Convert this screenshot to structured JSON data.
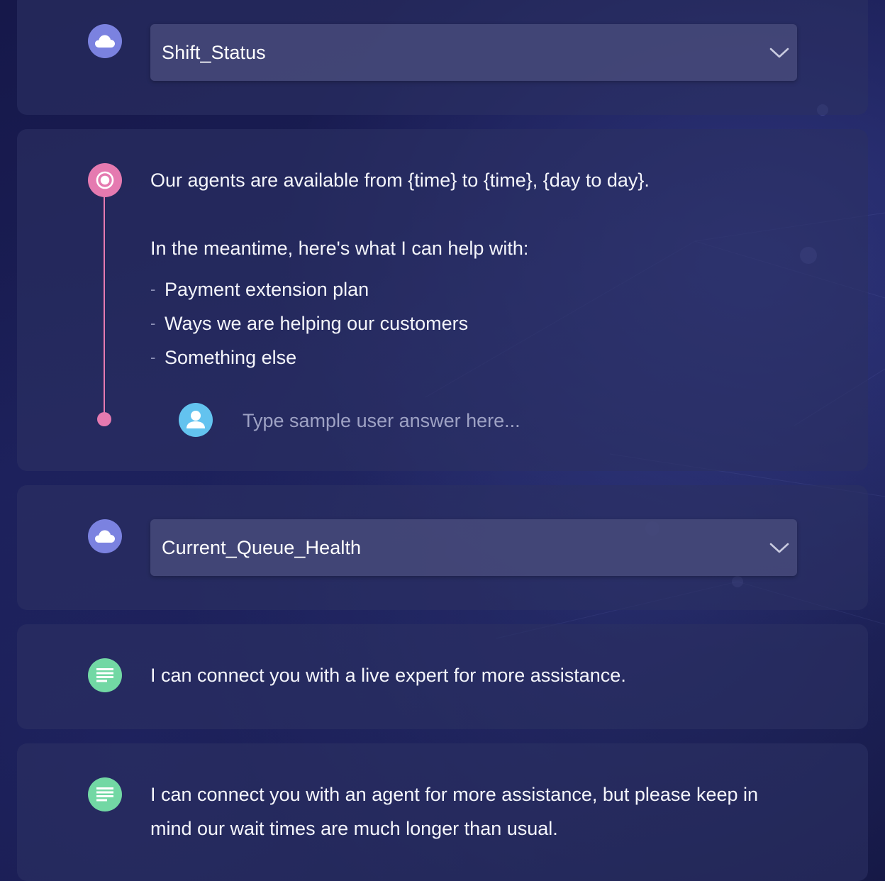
{
  "flow": {
    "nodes": [
      {
        "type": "api-call",
        "icon": "cloud-icon",
        "icon_color": "#7b82e0",
        "select_value": "Shift_Status"
      },
      {
        "type": "question",
        "icon": "target-icon",
        "icon_color": "#e57ab0",
        "line1": "Our agents are available from {time} to {time}, {day to day}.",
        "line2": "In the meantime, here's what I can help with:",
        "options": [
          "Payment extension plan",
          "Ways we are helping our customers",
          "Something else"
        ],
        "answer_icon": "user-icon",
        "answer_icon_color": "#63c3ef",
        "answer_placeholder": "Type sample user answer here..."
      },
      {
        "type": "api-call",
        "icon": "cloud-icon",
        "icon_color": "#7b82e0",
        "select_value": "Current_Queue_Health"
      },
      {
        "type": "message",
        "icon": "text-lines-icon",
        "icon_color": "#72d8a4",
        "text": "I can connect you with a live expert for more assistance."
      },
      {
        "type": "message",
        "icon": "text-lines-icon",
        "icon_color": "#72d8a4",
        "text_line1": "I can connect you with an agent for more assistance, but please keep in",
        "text_line2": "mind our wait times are much longer than usual."
      }
    ]
  }
}
